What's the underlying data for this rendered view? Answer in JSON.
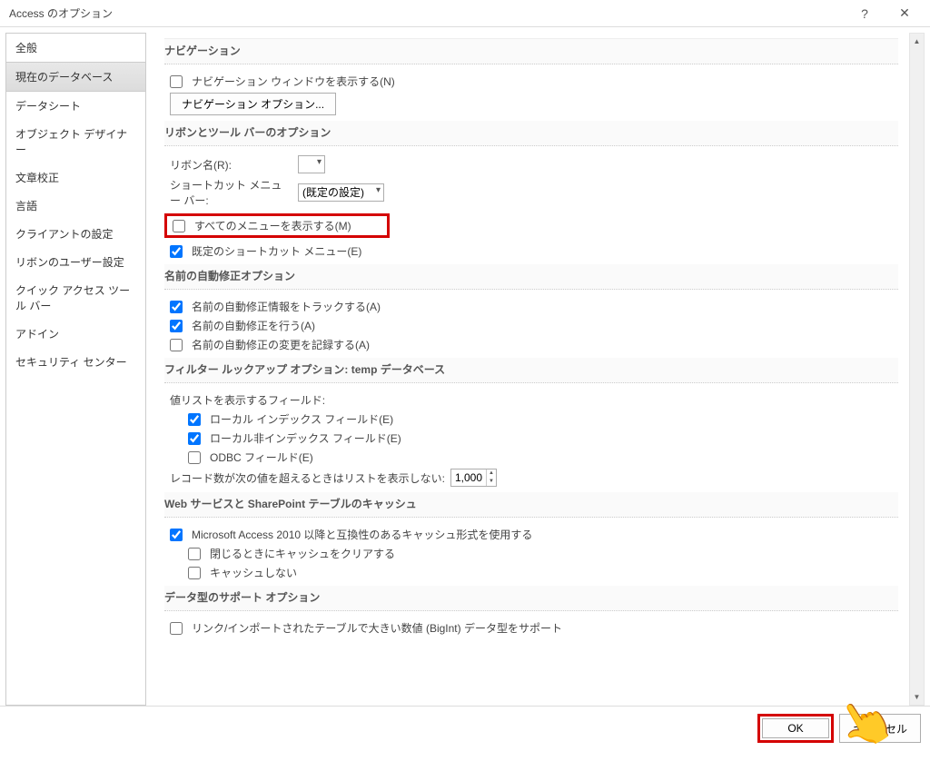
{
  "title": "Access のオプション",
  "sidebar": {
    "items": [
      {
        "label": "全般"
      },
      {
        "label": "現在のデータベース",
        "selected": true
      },
      {
        "label": "データシート"
      },
      {
        "label": "オブジェクト デザイナー"
      },
      {
        "label": "文章校正"
      },
      {
        "label": "言語"
      },
      {
        "label": "クライアントの設定"
      },
      {
        "label": "リボンのユーザー設定"
      },
      {
        "label": "クイック アクセス ツール バー"
      },
      {
        "label": "アドイン"
      },
      {
        "label": "セキュリティ センター"
      }
    ]
  },
  "sections": {
    "navigation": {
      "header": "ナビゲーション",
      "show_nav_window": "ナビゲーション ウィンドウを表示する(N)",
      "nav_options_btn": "ナビゲーション オプション..."
    },
    "ribbon_toolbar": {
      "header": "リボンとツール バーのオプション",
      "ribbon_name_label": "リボン名(R):",
      "shortcut_menu_bar_label": "ショートカット メニュー バー:",
      "shortcut_menu_bar_value": "(既定の設定)",
      "show_all_menus": "すべてのメニューを表示する(M)",
      "default_shortcut_menu": "既定のショートカット メニュー(E)"
    },
    "autocorrect": {
      "header": "名前の自動修正オプション",
      "track_info": "名前の自動修正情報をトラックする(A)",
      "do_autocorrect": "名前の自動修正を行う(A)",
      "log_changes": "名前の自動修正の変更を記録する(A)"
    },
    "filter_lookup": {
      "header": "フィルター ルックアップ オプション: temp データベース",
      "fields_label": "値リストを表示するフィールド:",
      "local_index": "ローカル インデックス フィールド(E)",
      "local_nonindex": "ローカル非インデックス フィールド(E)",
      "odbc": "ODBC フィールド(E)",
      "records_threshold_label": "レコード数が次の値を超えるときはリストを表示しない:",
      "records_threshold_value": "1,000"
    },
    "web_sp_cache": {
      "header": "Web サービスと SharePoint テーブルのキャッシュ",
      "compat2010": "Microsoft Access 2010 以降と互換性のあるキャッシュ形式を使用する",
      "clear_on_close": "閉じるときにキャッシュをクリアする",
      "no_cache": "キャッシュしない"
    },
    "datatype_support": {
      "header": "データ型のサポート オプション",
      "bigint": "リンク/インポートされたテーブルで大きい数値 (BigInt) データ型をサポート"
    }
  },
  "footer": {
    "ok": "OK",
    "cancel": "キャンセル"
  }
}
